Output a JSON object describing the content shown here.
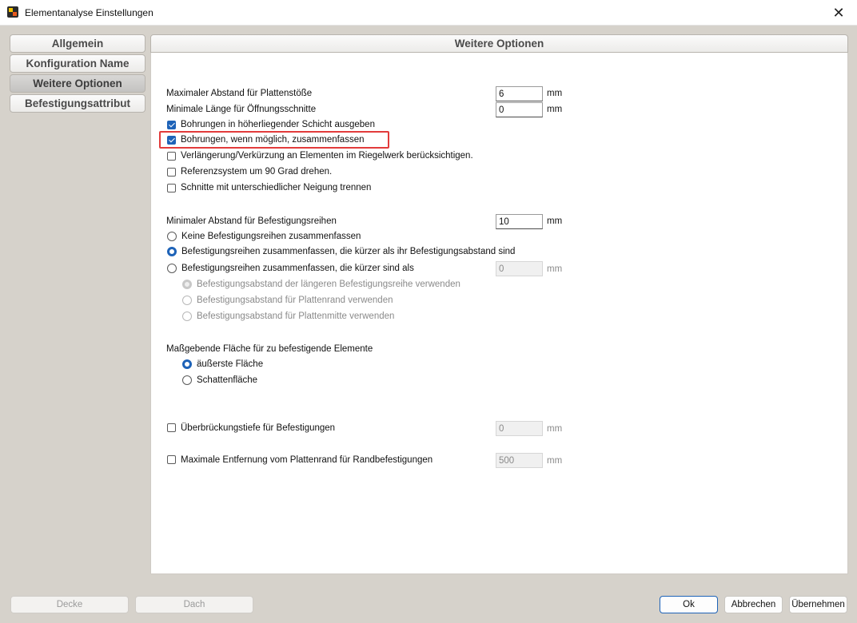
{
  "window": {
    "title": "Elementanalyse Einstellungen",
    "close_glyph": "✕"
  },
  "nav": {
    "tabs": [
      {
        "label": "Allgemein"
      },
      {
        "label": "Konfiguration Name"
      },
      {
        "label": "Weitere Optionen"
      },
      {
        "label": "Befestigungsattribut"
      }
    ],
    "active": "Weitere Optionen"
  },
  "panel": {
    "title": "Weitere Optionen"
  },
  "fields": {
    "max_abstand_plattenstoesse": {
      "label": "Maximaler Abstand für Plattenstöße",
      "value": "6",
      "unit": "mm"
    },
    "min_laenge_oeffnungsschnitte": {
      "label": "Minimale Länge für Öffnungsschnitte",
      "value": "0",
      "unit": "mm"
    },
    "min_abstand_befestigungsreihen": {
      "label": "Minimaler Abstand für Befestigungsreihen",
      "value": "10",
      "unit": "mm"
    },
    "zusammenfassen_kuerzer_als": {
      "value": "0",
      "unit": "mm"
    },
    "ueberbrueckungstiefe": {
      "value": "0",
      "unit": "mm"
    },
    "max_entfernung_plattenrand": {
      "value": "500",
      "unit": "mm"
    }
  },
  "checkboxes": {
    "bohrungen_hoeher": {
      "label": "Bohrungen in höherliegender Schicht ausgeben",
      "checked": true
    },
    "bohrungen_zusammenfassen": {
      "label": "Bohrungen, wenn möglich, zusammenfassen",
      "checked": true
    },
    "verlaengerung": {
      "label": "Verlängerung/Verkürzung an Elementen im Riegelwerk berücksichtigen.",
      "checked": false
    },
    "referenzsystem": {
      "label": "Referenzsystem um 90 Grad drehen.",
      "checked": false
    },
    "schnitte_neigung": {
      "label": "Schnitte mit unterschiedlicher Neigung trennen",
      "checked": false
    },
    "ueberbrueckungstiefe": {
      "label": "Überbrückungstiefe für Befestigungen",
      "checked": false
    },
    "max_entfernung": {
      "label": "Maximale Entfernung vom Plattenrand für Randbefestigungen",
      "checked": false
    }
  },
  "radios_reihen": {
    "keine": {
      "label": "Keine Befestigungsreihen zusammenfassen",
      "checked": false
    },
    "kuerzer_abstand": {
      "label": "Befestigungsreihen zusammenfassen, die kürzer als ihr Befestigungsabstand sind",
      "checked": true
    },
    "kuerzer_als": {
      "label": "Befestigungsreihen zusammenfassen, die kürzer sind als",
      "checked": false
    }
  },
  "radios_abstand": {
    "laengere_reihe": {
      "label": "Befestigungsabstand der längeren Befestigungsreihe verwenden",
      "checked": true
    },
    "plattenrand": {
      "label": "Befestigungsabstand für Plattenrand verwenden",
      "checked": false
    },
    "plattenmitte": {
      "label": "Befestigungsabstand für Plattenmitte verwenden",
      "checked": false
    }
  },
  "flaeche": {
    "label": "Maßgebende Fläche für zu befestigende Elemente",
    "aeusserste": {
      "label": "äußerste Fläche",
      "checked": true
    },
    "schatten": {
      "label": "Schattenfläche",
      "checked": false
    }
  },
  "footer": {
    "decke": "Decke",
    "dach": "Dach",
    "ok": "Ok",
    "abbrechen": "Abbrechen",
    "uebernehmen": "Übernehmen"
  },
  "colors": {
    "accent": "#1e63b8",
    "highlight": "#e23b3b",
    "background": "#d6d2cb"
  }
}
